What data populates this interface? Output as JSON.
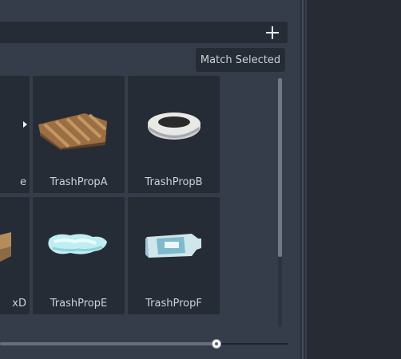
{
  "toolbar": {
    "add_icon": "plus-icon",
    "match_selected_label": "Match Selected"
  },
  "grid": {
    "row1": [
      {
        "label": "e"
      },
      {
        "label": "TrashPropA"
      },
      {
        "label": "TrashPropB"
      }
    ],
    "row2": [
      {
        "label": "xD"
      },
      {
        "label": "TrashPropE"
      },
      {
        "label": "TrashPropF"
      }
    ]
  },
  "colors": {
    "panel_bg": "#363d4a",
    "tile_bg": "#262c35",
    "text": "#cdd1d8"
  }
}
